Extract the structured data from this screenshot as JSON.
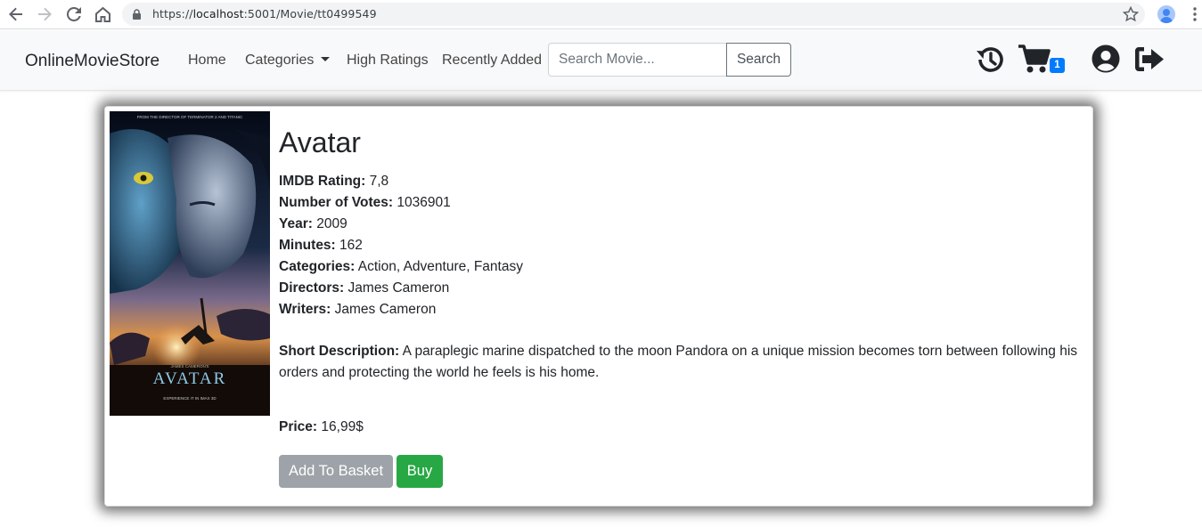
{
  "browser": {
    "url_scheme": "https://",
    "url_host": "localhost",
    "url_rest": ":5001/Movie/tt0499549"
  },
  "navbar": {
    "brand": "OnlineMovieStore",
    "home": "Home",
    "categories": "Categories",
    "high_ratings": "High Ratings",
    "recently_added": "Recently Added",
    "search_placeholder": "Search Movie...",
    "search_button": "Search",
    "cart_count": "1",
    "icons": [
      "history-icon",
      "cart-icon",
      "user-icon",
      "logout-icon"
    ]
  },
  "movie": {
    "poster_text": {
      "tagline": "FROM THE DIRECTOR OF TERMINATOR 2 AND TITANIC",
      "credit": "JAMES CAMERON'S",
      "title": "AVATAR",
      "footer": "EXPERIENCE IT IN IMAX 3D"
    },
    "title": "Avatar",
    "labels": {
      "rating": "IMDB Rating:",
      "votes": "Number of Votes:",
      "year": "Year:",
      "minutes": "Minutes:",
      "categories": "Categories:",
      "directors": "Directors:",
      "writers": "Writers:",
      "description": "Short Description:",
      "price": "Price:"
    },
    "rating": "7,8",
    "votes": "1036901",
    "year": "2009",
    "minutes": "162",
    "categories": "Action, Adventure, Fantasy",
    "directors": "James Cameron",
    "writers": "James Cameron",
    "description": "A paraplegic marine dispatched to the moon Pandora on a unique mission becomes torn between following his orders and protecting the world he feels is his home.",
    "price": "16,99$"
  },
  "actions": {
    "add_to_basket": "Add To Basket",
    "buy": "Buy"
  },
  "colors": {
    "accent": "#007bff",
    "buy": "#28a745",
    "basket": "#9da3a8"
  }
}
